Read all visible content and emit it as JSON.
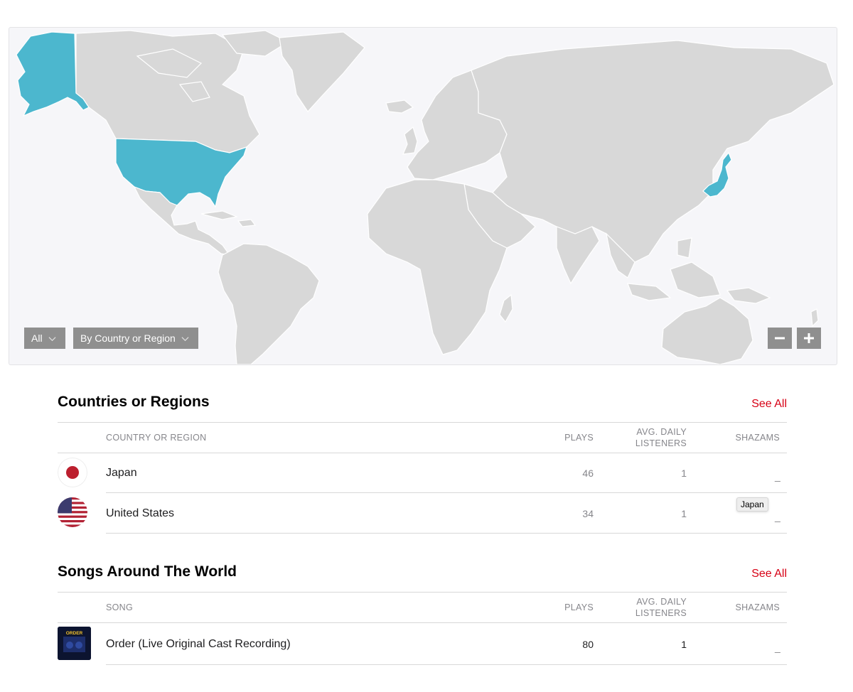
{
  "map": {
    "filter_all_label": "All",
    "filter_region_label": "By Country or Region",
    "zoom_out_icon": "minus-icon",
    "zoom_in_icon": "plus-icon",
    "colors": {
      "land": "#d8d8d8",
      "highlight": "#4cb7ce",
      "ocean": "#f6f6f9"
    },
    "highlighted_regions": [
      "United States",
      "Japan"
    ]
  },
  "countries": {
    "title": "Countries or Regions",
    "see_all": "See All",
    "headers": {
      "name": "COUNTRY OR REGION",
      "plays": "PLAYS",
      "listeners_line1": "AVG. DAILY",
      "listeners_line2": "LISTENERS",
      "shazams": "SHAZAMS"
    },
    "rows": [
      {
        "name": "Japan",
        "plays": "46",
        "listeners": "1",
        "shazams": "_",
        "flag": "japan-flag-icon"
      },
      {
        "name": "United States",
        "plays": "34",
        "listeners": "1",
        "shazams": "_",
        "flag": "us-flag-icon"
      }
    ]
  },
  "tooltip": {
    "text": "Japan"
  },
  "songs": {
    "title": "Songs Around The World",
    "see_all": "See All",
    "headers": {
      "name": "SONG",
      "plays": "PLAYS",
      "listeners_line1": "AVG. DAILY",
      "listeners_line2": "LISTENERS",
      "shazams": "SHAZAMS"
    },
    "rows": [
      {
        "name": "Order (Live Original Cast Recording)",
        "plays": "80",
        "listeners": "1",
        "shazams": "_"
      }
    ],
    "album_art_text": "ORDER"
  }
}
